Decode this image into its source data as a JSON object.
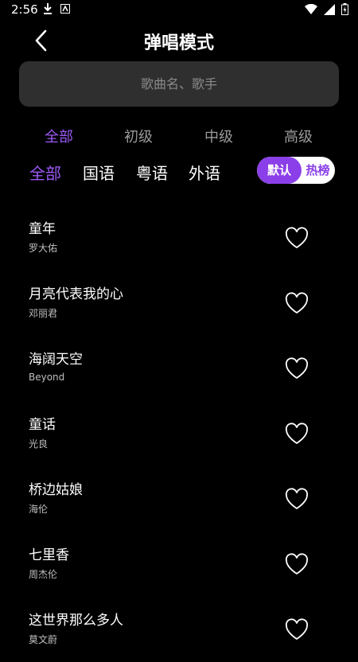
{
  "status": {
    "time": "2:56"
  },
  "header": {
    "title": "弹唱模式"
  },
  "search": {
    "placeholder": "歌曲名、歌手"
  },
  "level_tabs": [
    {
      "label": "全部",
      "active": true
    },
    {
      "label": "初级",
      "active": false
    },
    {
      "label": "中级",
      "active": false
    },
    {
      "label": "高级",
      "active": false
    }
  ],
  "lang_tabs": [
    {
      "label": "全部",
      "active": true
    },
    {
      "label": "国语",
      "active": false
    },
    {
      "label": "粤语",
      "active": false
    },
    {
      "label": "外语",
      "active": false
    }
  ],
  "sort": {
    "default_label": "默认",
    "hot_label": "热榜",
    "selected": "默认"
  },
  "songs": [
    {
      "title": "童年",
      "artist": "罗大佑"
    },
    {
      "title": "月亮代表我的心",
      "artist": "邓丽君"
    },
    {
      "title": "海阔天空",
      "artist": "Beyond"
    },
    {
      "title": "童话",
      "artist": "光良"
    },
    {
      "title": "桥边姑娘",
      "artist": "海伦"
    },
    {
      "title": "七里香",
      "artist": "周杰伦"
    },
    {
      "title": "这世界那么多人",
      "artist": "莫文蔚"
    }
  ],
  "colors": {
    "accent": "#8b3fe8",
    "background": "#000000",
    "search_bg": "#2f2f2f"
  }
}
